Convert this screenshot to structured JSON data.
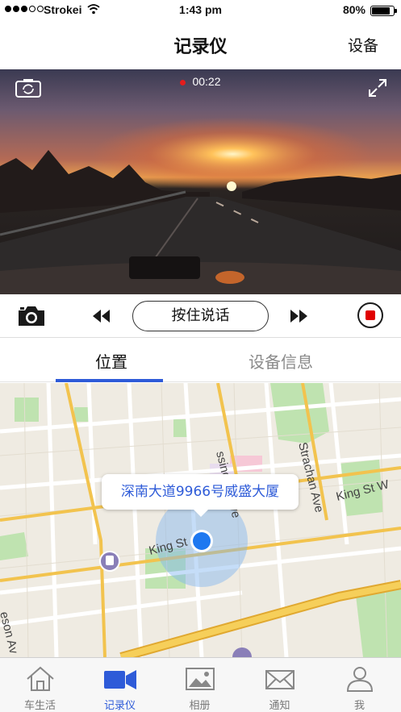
{
  "status_bar": {
    "carrier": "Strokei",
    "time": "1:43 pm",
    "battery": "80%",
    "battery_level": 0.8
  },
  "nav": {
    "title": "记录仪",
    "right_button": "设备"
  },
  "video": {
    "recording_time": "00:22",
    "rec_color": "#e51c1c"
  },
  "controls": {
    "talk_button": "按住说话"
  },
  "tabs": [
    {
      "label": "位置",
      "active": true
    },
    {
      "label": "设备信息",
      "active": false
    }
  ],
  "map": {
    "callout": "深南大道9966号威盛大厦",
    "streets": [
      "ssington Ave",
      "Strachan Ave",
      "King St W",
      "King St",
      "eson Av"
    ]
  },
  "tabbar": [
    {
      "label": "车生活",
      "icon": "home-icon"
    },
    {
      "label": "记录仪",
      "icon": "video-camera-icon",
      "active": true
    },
    {
      "label": "相册",
      "icon": "photo-album-icon"
    },
    {
      "label": "通知",
      "icon": "mail-icon"
    },
    {
      "label": "我",
      "icon": "person-icon"
    }
  ],
  "colors": {
    "accent": "#2e5bd8",
    "stop_red": "#e00000"
  }
}
